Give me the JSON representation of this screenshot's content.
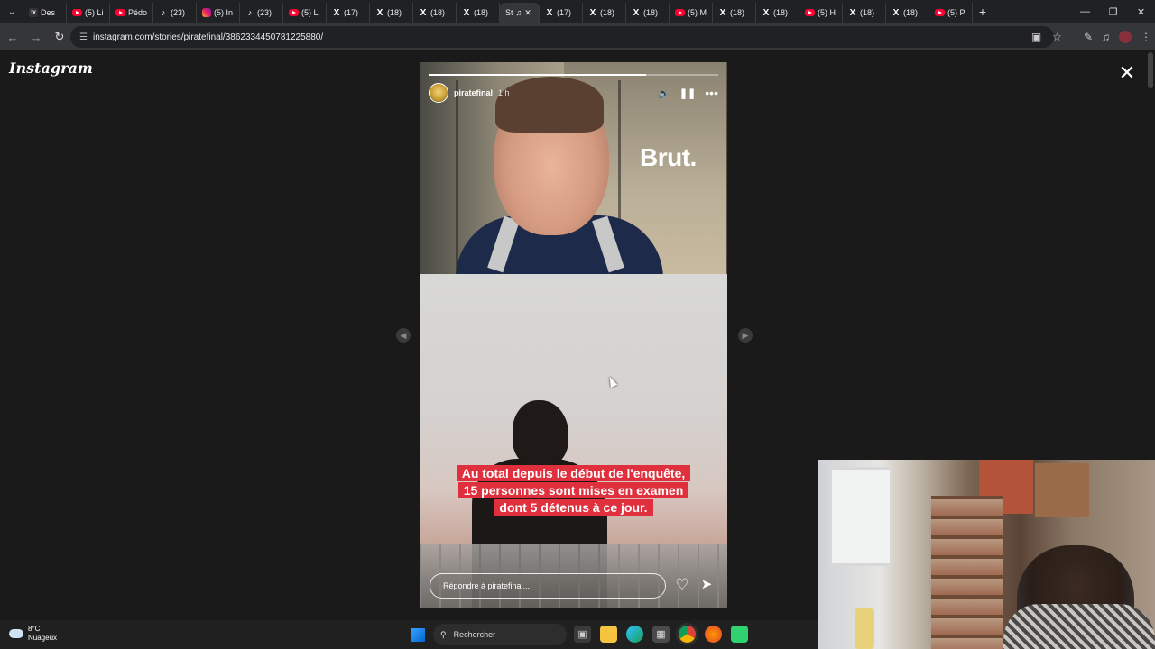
{
  "browser": {
    "tabs": [
      {
        "label": "Des",
        "icon": "dev-icon"
      },
      {
        "label": "(5) Li",
        "icon": "youtube-icon"
      },
      {
        "label": "Pédo",
        "icon": "youtube-icon"
      },
      {
        "label": "(23)",
        "icon": "tiktok-icon"
      },
      {
        "label": "(5) In",
        "icon": "instagram-icon"
      },
      {
        "label": "(23)",
        "icon": "tiktok-icon"
      },
      {
        "label": "(5) Li",
        "icon": "youtube-icon"
      },
      {
        "label": "(17)",
        "icon": "x-icon"
      },
      {
        "label": "(18)",
        "icon": "x-icon"
      },
      {
        "label": "(18)",
        "icon": "x-icon"
      },
      {
        "label": "(18)",
        "icon": "x-icon"
      },
      {
        "label": "St",
        "icon": "audio-icon"
      },
      {
        "label": "(17)",
        "icon": "x-icon"
      },
      {
        "label": "(18)",
        "icon": "x-icon"
      },
      {
        "label": "(18)",
        "icon": "x-icon"
      },
      {
        "label": "(5) M",
        "icon": "youtube-icon"
      },
      {
        "label": "(18)",
        "icon": "x-icon"
      },
      {
        "label": "(18)",
        "icon": "x-icon"
      },
      {
        "label": "(5) H",
        "icon": "youtube-icon"
      },
      {
        "label": "(18)",
        "icon": "x-icon"
      },
      {
        "label": "(18)",
        "icon": "x-icon"
      },
      {
        "label": "(5) P",
        "icon": "youtube-icon"
      }
    ],
    "active_tab_index": 11,
    "url": "instagram.com/stories/piratefinal/3862334450781225880/"
  },
  "page": {
    "logo": "Instagram",
    "story": {
      "username": "piratefinal",
      "time": "1 h",
      "brand_overlay": "Brut.",
      "caption": "Au total depuis le début de l'enquête, 15 personnes sont mises en examen dont 5 détenus à ce jour.",
      "reply_placeholder": "Répondre à piratefinal...",
      "progress": 0.75
    }
  },
  "taskbar": {
    "temperature": "8°C",
    "weather": "Nuageux",
    "search_label": "Rechercher"
  },
  "colors": {
    "caption_bg": "#e0303d",
    "page_bg": "#1a1a1a"
  }
}
